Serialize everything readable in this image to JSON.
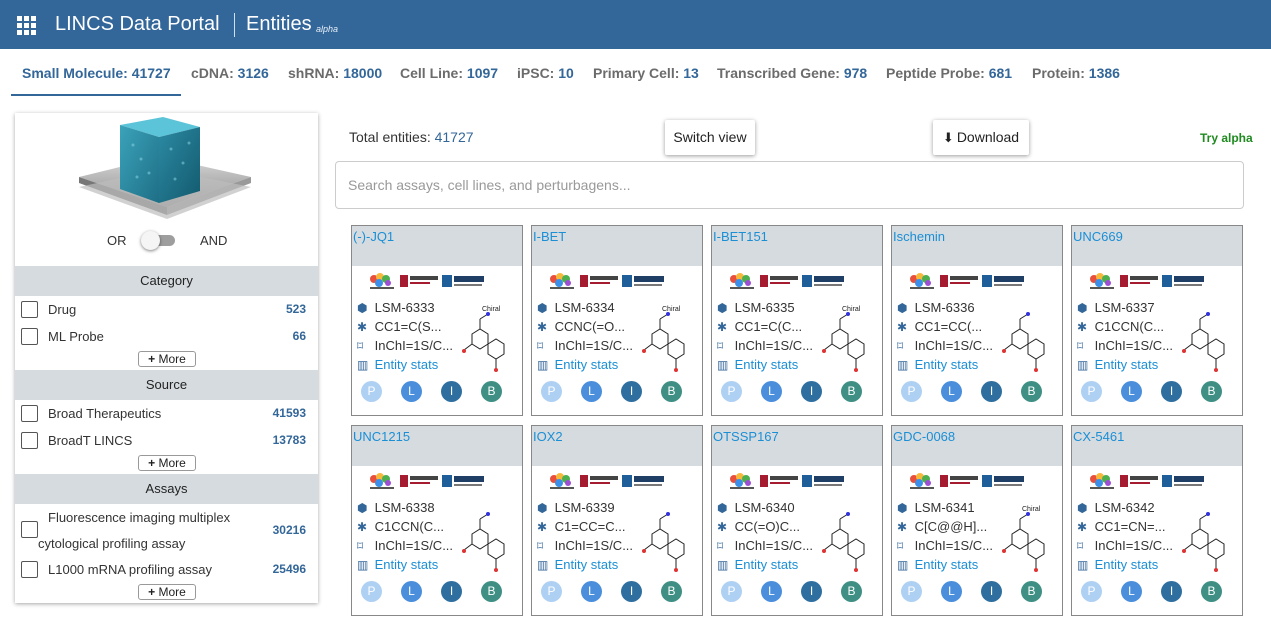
{
  "header": {
    "app_title": "LINCS Data Portal",
    "page_title": "Entities",
    "page_badge": "alpha"
  },
  "tabs": [
    {
      "label": "Small Molecule:",
      "count": "41727",
      "active": true
    },
    {
      "label": "cDNA:",
      "count": "3126"
    },
    {
      "label": "shRNA:",
      "count": "18000"
    },
    {
      "label": "Cell Line:",
      "count": "1097"
    },
    {
      "label": "iPSC:",
      "count": "10"
    },
    {
      "label": "Primary Cell:",
      "count": "13"
    },
    {
      "label": "Transcribed Gene:",
      "count": "978"
    },
    {
      "label": "Peptide Probe:",
      "count": "681"
    },
    {
      "label": "Protein:",
      "count": "1386"
    }
  ],
  "sidebar": {
    "toggle": {
      "left_label": "OR",
      "right_label": "AND",
      "state": "OR"
    },
    "sections": [
      {
        "title": "Category",
        "items": [
          {
            "label": "Drug",
            "count": "523"
          },
          {
            "label": "ML Probe",
            "count": "66"
          }
        ],
        "more": "More"
      },
      {
        "title": "Source",
        "items": [
          {
            "label": "Broad Therapeutics",
            "count": "41593"
          },
          {
            "label": "BroadT LINCS",
            "count": "13783"
          }
        ],
        "more": "More"
      },
      {
        "title": "Assays",
        "items": [
          {
            "label_line1": "Fluorescence imaging multiplex",
            "label_line2": "cytological profiling assay",
            "count": "30216"
          },
          {
            "label": "L1000 mRNA profiling assay",
            "count": "25496"
          }
        ],
        "more": "More"
      }
    ]
  },
  "main": {
    "total_label": "Total entities:",
    "total_count": "41727",
    "switch_view": "Switch view",
    "download": "Download",
    "try_alpha": "Try alpha",
    "search_placeholder": "Search assays, cell lines, and perturbagens..."
  },
  "card_labels": {
    "stats": "Entity stats",
    "badges": [
      "P",
      "L",
      "I",
      "B"
    ],
    "chiral": "Chiral"
  },
  "cards": [
    {
      "name": "(-)-JQ1",
      "id": "LSM-6333",
      "smiles": "CC1=C(S...",
      "inchi": "InChI=1S/C...",
      "chiral": true
    },
    {
      "name": "I-BET",
      "id": "LSM-6334",
      "smiles": "CCNC(=O...",
      "inchi": "InChI=1S/C...",
      "chiral": true
    },
    {
      "name": "I-BET151",
      "id": "LSM-6335",
      "smiles": "CC1=C(C...",
      "inchi": "InChI=1S/C...",
      "chiral": true
    },
    {
      "name": "Ischemin",
      "id": "LSM-6336",
      "smiles": "CC1=CC(...",
      "inchi": "InChI=1S/C...",
      "chiral": false
    },
    {
      "name": "UNC669",
      "id": "LSM-6337",
      "smiles": "C1CCN(C...",
      "inchi": "InChI=1S/C...",
      "chiral": false
    },
    {
      "name": "UNC1215",
      "id": "LSM-6338",
      "smiles": "C1CCN(C...",
      "inchi": "InChI=1S/C...",
      "chiral": false
    },
    {
      "name": "IOX2",
      "id": "LSM-6339",
      "smiles": "C1=CC=C...",
      "inchi": "InChI=1S/C...",
      "chiral": false
    },
    {
      "name": "OTSSP167",
      "id": "LSM-6340",
      "smiles": "CC(=O)C...",
      "inchi": "InChI=1S/C...",
      "chiral": false
    },
    {
      "name": "GDC-0068",
      "id": "LSM-6341",
      "smiles": "C[C@@H]...",
      "inchi": "InChI=1S/C...",
      "chiral": true
    },
    {
      "name": "CX-5461",
      "id": "LSM-6342",
      "smiles": "CC1=CN=...",
      "inchi": "InChI=1S/C...",
      "chiral": false
    }
  ],
  "colors": {
    "header": "#336699",
    "accent": "#336699",
    "link": "#1a8fd6",
    "try_alpha": "#1f8a1f"
  }
}
